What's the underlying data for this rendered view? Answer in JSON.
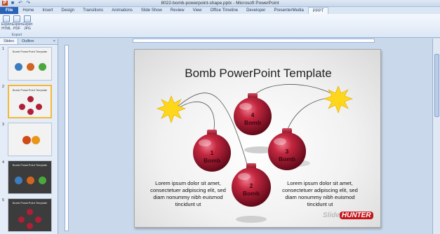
{
  "window": {
    "title": "8022-bomb-powerpoint-shape.pptx - Microsoft PowerPoint"
  },
  "ribbon": {
    "tabs": [
      "File",
      "Home",
      "Insert",
      "Design",
      "Transitions",
      "Animations",
      "Slide Show",
      "Review",
      "View",
      "Office Timeline",
      "Developer",
      "PresenterMedia",
      "PPPT"
    ],
    "active_tab": "PPPT",
    "buttons": [
      {
        "label": "Export HTML"
      },
      {
        "label": "Export PDF"
      },
      {
        "label": "Export JPG"
      }
    ],
    "group_label": "Export"
  },
  "left_pane": {
    "tabs": [
      "Slides",
      "Outline"
    ],
    "close_glyph": "×",
    "thumbnails": [
      {
        "num": "1",
        "title": "Bomb PowerPoint Template"
      },
      {
        "num": "2",
        "title": "Bomb PowerPoint Template"
      },
      {
        "num": "3",
        "title": ""
      },
      {
        "num": "4",
        "title": "Bomb PowerPoint Template"
      },
      {
        "num": "5",
        "title": "Bomb PowerPoint Template"
      }
    ],
    "selected": 2
  },
  "slide": {
    "title": "Bomb PowerPoint Template",
    "bombs": [
      {
        "num": "1",
        "label": "Bomb"
      },
      {
        "num": "2",
        "label": "Bomb"
      },
      {
        "num": "3",
        "label": "Bomb"
      },
      {
        "num": "4",
        "label": "Bomb"
      }
    ],
    "text_left": "Lorem ipsum dolor sit amet, consectetuer adipiscing elit, sed diam nonummy nibh euismod tincidunt ut",
    "text_right": "Lorem ipsum dolor sit amet, consectetuer adipiscing elit, sed diam nonummy nibh euismod tincidunt ut",
    "logo_part1": "Slide",
    "logo_part2": "HUNTER"
  },
  "colors": {
    "bomb": "#b01f37",
    "spark": "#ffd71a",
    "file_tab": "#2a62b8"
  }
}
